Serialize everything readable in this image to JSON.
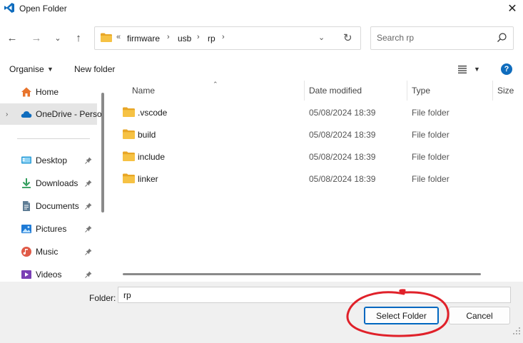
{
  "window": {
    "title": "Open Folder",
    "close_glyph": "✕",
    "app_icon": "vscode-icon"
  },
  "nav": {
    "back_glyph": "←",
    "forward_glyph": "→",
    "recent_glyph": "⌄",
    "up_glyph": "↑"
  },
  "address": {
    "overflow_glyph": "«",
    "crumbs": [
      "firmware",
      "usb",
      "rp"
    ],
    "sep_glyph": "›",
    "dropdown_glyph": "⌄",
    "refresh_glyph": "↻"
  },
  "search": {
    "placeholder": "Search rp"
  },
  "toolbar": {
    "organise_label": "Organise",
    "new_folder_label": "New folder",
    "help_label": "?"
  },
  "sidebar": {
    "items": [
      {
        "label": "Home",
        "icon": "home-icon"
      },
      {
        "label": "OneDrive - Perso",
        "icon": "onedrive-cloud-icon"
      },
      {
        "label": "Desktop",
        "icon": "desktop-icon",
        "pinned": true
      },
      {
        "label": "Downloads",
        "icon": "download-icon",
        "pinned": true
      },
      {
        "label": "Documents",
        "icon": "documents-icon",
        "pinned": true
      },
      {
        "label": "Pictures",
        "icon": "pictures-icon",
        "pinned": true
      },
      {
        "label": "Music",
        "icon": "music-icon",
        "pinned": true
      },
      {
        "label": "Videos",
        "icon": "videos-icon",
        "pinned": true
      }
    ]
  },
  "filelist": {
    "columns": [
      "Name",
      "Date modified",
      "Type",
      "Size"
    ],
    "rows": [
      {
        "name": ".vscode",
        "date": "05/08/2024 18:39",
        "type": "File folder"
      },
      {
        "name": "build",
        "date": "05/08/2024 18:39",
        "type": "File folder"
      },
      {
        "name": "include",
        "date": "05/08/2024 18:39",
        "type": "File folder"
      },
      {
        "name": "linker",
        "date": "05/08/2024 18:39",
        "type": "File folder"
      }
    ]
  },
  "footer": {
    "folder_label": "Folder:",
    "folder_value": "rp",
    "select_label": "Select Folder",
    "cancel_label": "Cancel"
  },
  "colors": {
    "accent": "#0067c0",
    "folder": "#f6c244",
    "annotation": "#e0212a"
  }
}
